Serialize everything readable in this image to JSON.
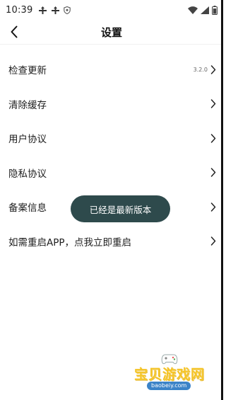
{
  "status_bar": {
    "time": "10:39",
    "left_icons": [
      "relay-icon",
      "relay-icon",
      "shield-icon"
    ],
    "right_icons": [
      "wifi-icon",
      "signal-icon",
      "battery-icon"
    ]
  },
  "header": {
    "title": "设置",
    "back_icon": "chevron-left-icon"
  },
  "settings": {
    "items": [
      {
        "label": "检查更新",
        "value": "3.2.0"
      },
      {
        "label": "清除缓存",
        "value": ""
      },
      {
        "label": "用户协议",
        "value": ""
      },
      {
        "label": "隐私协议",
        "value": ""
      },
      {
        "label": "备案信息",
        "value": ""
      },
      {
        "label": "如需重启APP，点我立即重启",
        "value": ""
      }
    ]
  },
  "toast": {
    "text": "已经是最新版本"
  },
  "watermark": {
    "title": "宝贝游戏网",
    "url": "baobeiy.com"
  },
  "colors": {
    "toast_bg": "#2e4a4c",
    "text": "#1e1e1e",
    "watermark_yellow": "#f5c426",
    "watermark_blue": "#3b83c8"
  }
}
